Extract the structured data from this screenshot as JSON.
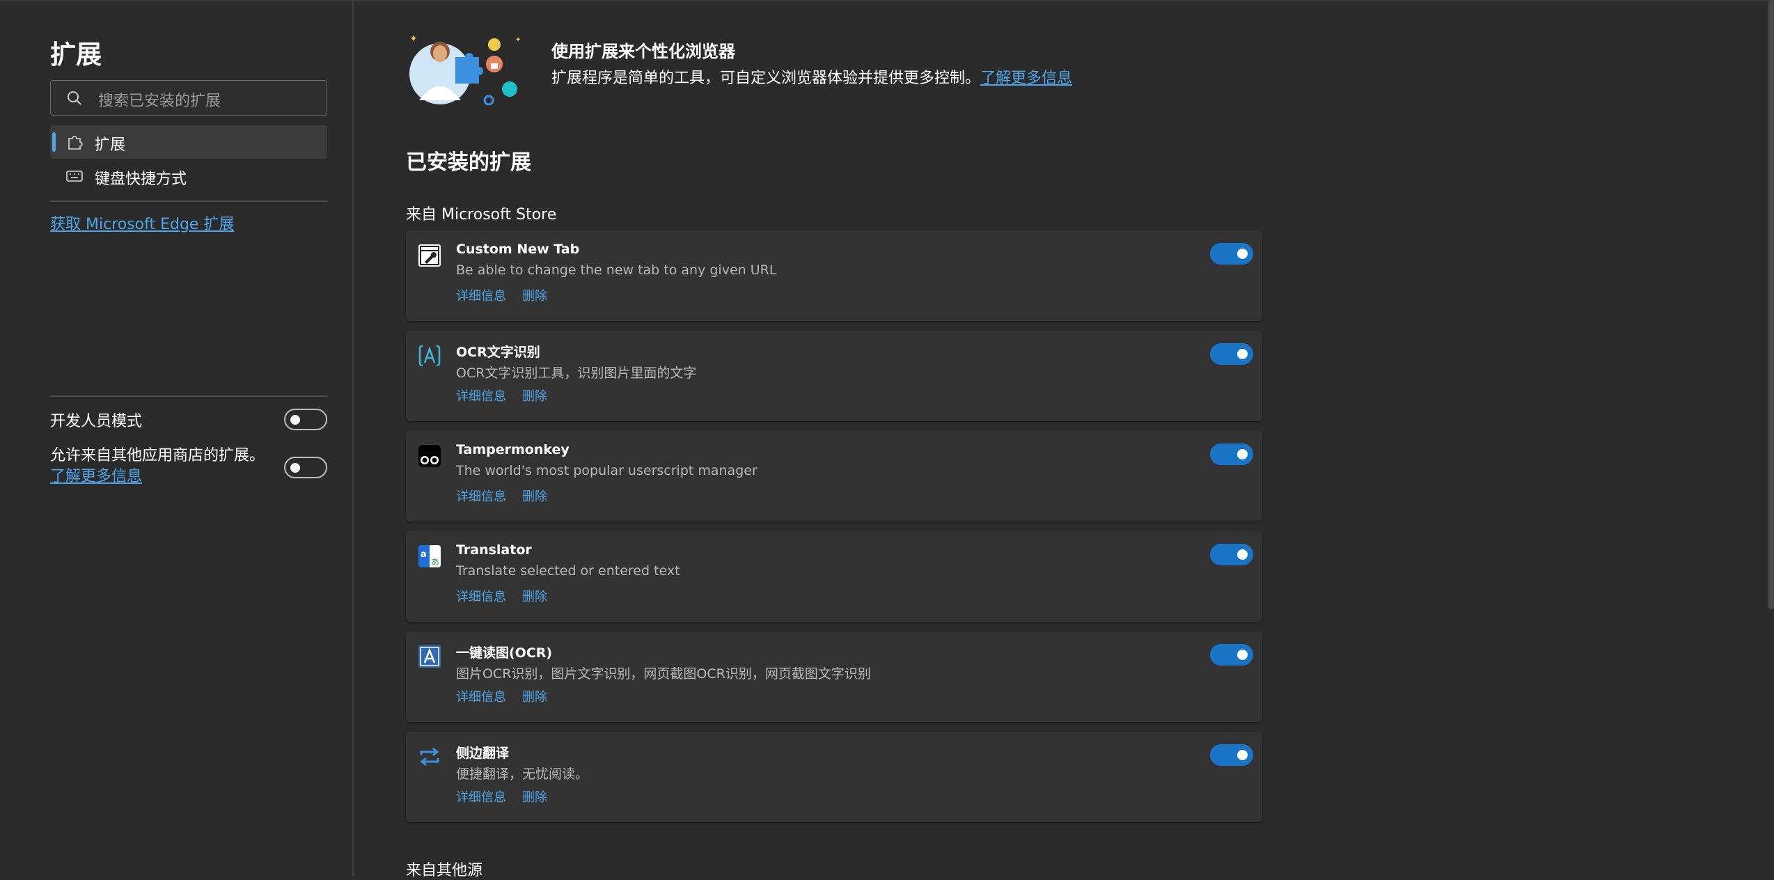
{
  "sidebar": {
    "title": "扩展",
    "search_placeholder": "搜索已安装的扩展",
    "nav": [
      {
        "label": "扩展",
        "icon": "puzzle-icon",
        "active": true
      },
      {
        "label": "键盘快捷方式",
        "icon": "keyboard-icon",
        "active": false
      }
    ],
    "get_link": "获取 Microsoft Edge 扩展",
    "dev_mode_label": "开发人员模式",
    "dev_mode_on": false,
    "allow_other_stores_text": "允许来自其他应用商店的扩展。",
    "allow_other_stores_link": "了解更多信息",
    "allow_other_stores_on": false
  },
  "hero": {
    "title": "使用扩展来个性化浏览器",
    "desc": "扩展程序是简单的工具，可自定义浏览器体验并提供更多控制。",
    "link": "了解更多信息"
  },
  "main": {
    "installed_title": "已安装的扩展",
    "source_store": "来自 Microsoft Store",
    "source_other": "来自其他源",
    "detail_label": "详细信息",
    "remove_label": "删除",
    "extensions": [
      {
        "name": "Custom New Tab",
        "desc": "Be able to change the new tab to any given URL",
        "icon": "wrench-tab-icon",
        "enabled": true
      },
      {
        "name": "OCR文字识别",
        "desc": "OCR文字识别工具，识别图片里面的文字",
        "icon": "ocr-bracket-a-icon",
        "enabled": true
      },
      {
        "name": "Tampermonkey",
        "desc": "The world's most popular userscript manager",
        "icon": "tampermonkey-icon",
        "enabled": true
      },
      {
        "name": "Translator",
        "desc": "Translate selected or entered text",
        "icon": "translator-icon",
        "enabled": true
      },
      {
        "name": "一键读图(OCR)",
        "desc": "图片OCR识别，图片文字识别，网页截图OCR识别，网页截图文字识别",
        "icon": "ocr-a-icon",
        "enabled": true
      },
      {
        "name": "侧边翻译",
        "desc": "便捷翻译，无忧阅读。",
        "icon": "swap-arrows-icon",
        "enabled": true
      }
    ]
  },
  "colors": {
    "accent": "#4ea6ea",
    "toggle_on": "#1a74c8",
    "background": "#2b2b2b",
    "card": "#333333"
  }
}
